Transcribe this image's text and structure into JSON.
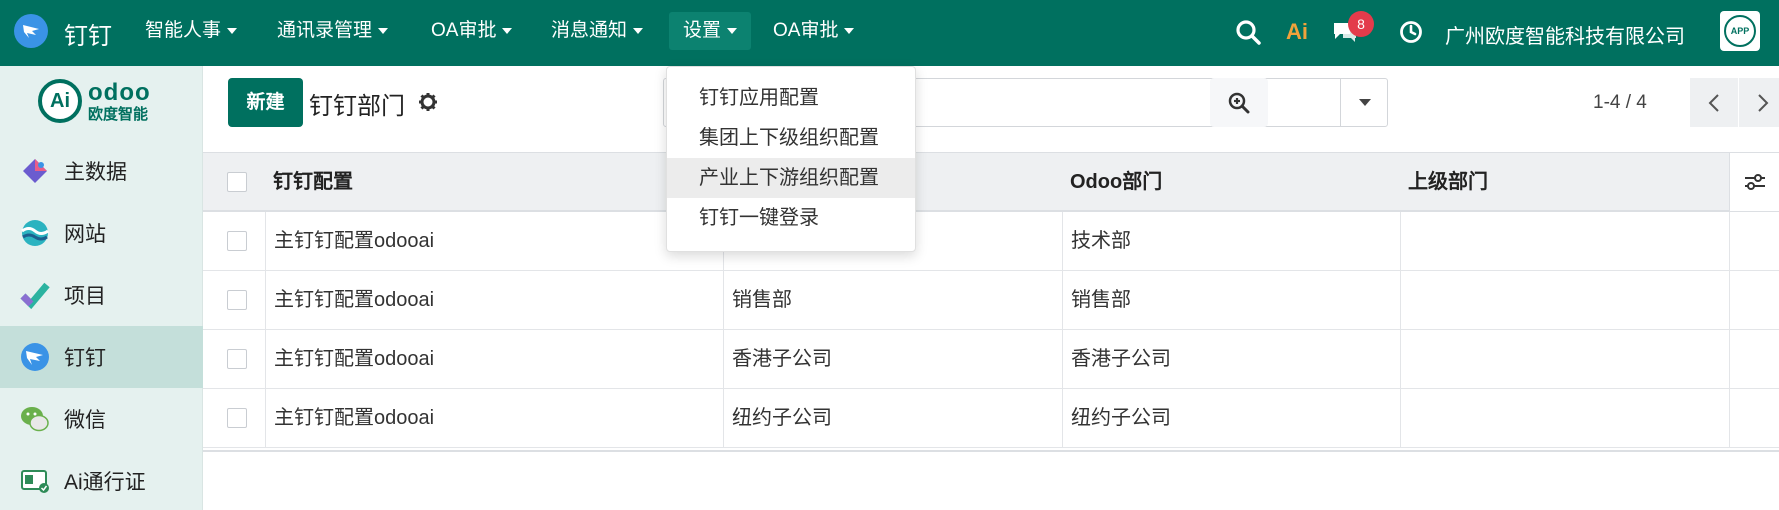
{
  "topbar": {
    "app_name": "钉钉",
    "menus": [
      {
        "label": "智能人事"
      },
      {
        "label": "通讯录管理"
      },
      {
        "label": "OA审批"
      },
      {
        "label": "消息通知"
      },
      {
        "label": "设置"
      },
      {
        "label": "OA审批"
      }
    ],
    "ai_label": "Ai",
    "message_count": "8",
    "company": "广州欧度智能科技有限公司",
    "app_logo_text": "APP"
  },
  "sidebar": {
    "brand_mark": "Ai",
    "brand_name": "odoo",
    "brand_sub": "欧度智能",
    "items": [
      {
        "label": "主数据"
      },
      {
        "label": "网站"
      },
      {
        "label": "项目"
      },
      {
        "label": "钉钉"
      },
      {
        "label": "微信"
      },
      {
        "label": "Ai通行证"
      }
    ]
  },
  "control": {
    "new_label": "新建",
    "title": "钉钉部门",
    "pager": "1-4 / 4"
  },
  "dropdown": {
    "items": [
      {
        "label": "钉钉应用配置"
      },
      {
        "label": "集团上下级组织配置"
      },
      {
        "label": "产业上下游组织配置"
      },
      {
        "label": "钉钉一键登录"
      }
    ]
  },
  "table": {
    "headers": [
      "钉钉配置",
      "",
      "Odoo部门",
      "上级部门"
    ],
    "rows": [
      {
        "config": "主钉钉配置odooai",
        "name": "",
        "odoo": "技术部",
        "parent": ""
      },
      {
        "config": "主钉钉配置odooai",
        "name": "销售部",
        "odoo": "销售部",
        "parent": ""
      },
      {
        "config": "主钉钉配置odooai",
        "name": "香港子公司",
        "odoo": "香港子公司",
        "parent": ""
      },
      {
        "config": "主钉钉配置odooai",
        "name": "纽约子公司",
        "odoo": "纽约子公司",
        "parent": ""
      }
    ]
  },
  "colors": {
    "brand": "#00705f",
    "sidebar_bg": "#e5f1ef",
    "badge": "#e33b4b"
  }
}
